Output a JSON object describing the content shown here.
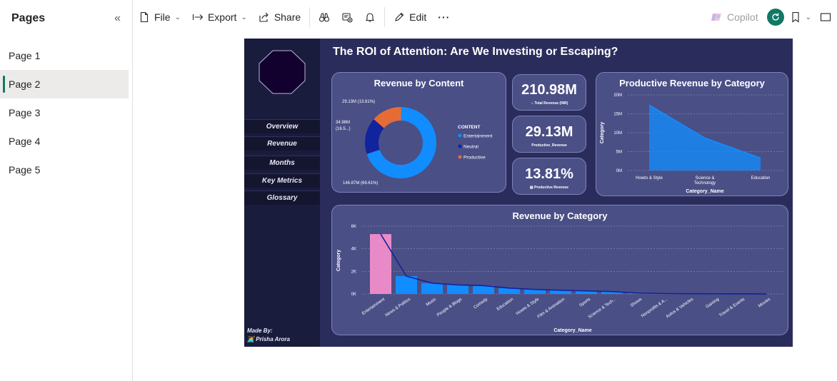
{
  "pages_pane": {
    "title": "Pages",
    "collapse_icon": "double-chevron-left-icon",
    "items": [
      {
        "label": "Page 1"
      },
      {
        "label": "Page 2"
      },
      {
        "label": "Page 3"
      },
      {
        "label": "Page 4"
      },
      {
        "label": "Page 5"
      }
    ],
    "active_index": 1
  },
  "toolbar": {
    "file_label": "File",
    "export_label": "Export",
    "share_label": "Share",
    "edit_label": "Edit",
    "more_label": "···",
    "copilot_label": "Copilot",
    "accent": "#117865"
  },
  "report": {
    "title": "The ROI of Attention: Are We Investing or Escaping?",
    "nav": [
      "Overview",
      "Revenue",
      "Months",
      "Key Metrics",
      "Glossary"
    ],
    "made_by_label": "Made By:",
    "author": "Prisha Arora",
    "kpis": [
      {
        "value": "210.98M",
        "label": "Total Revenue (INR)"
      },
      {
        "value": "29.13M",
        "label": "Productive_Revenue"
      },
      {
        "value": "13.81%",
        "label": "Productive Revenue"
      }
    ]
  },
  "chart_data": [
    {
      "type": "pie",
      "title": "Revenue by Content",
      "legend_title": "CONTENT",
      "legend_position": "right",
      "slices": [
        {
          "name": "Entertainment",
          "value": 146.87,
          "label": "146.87M (69.61%)",
          "color": "#118dff"
        },
        {
          "name": "Neutral",
          "value": 34.98,
          "label": "34.98M (16.5...)",
          "color": "#12239e"
        },
        {
          "name": "Productive",
          "value": 29.13,
          "label": "29.13M (13.81%)",
          "color": "#e66c37"
        }
      ]
    },
    {
      "type": "area",
      "title": "Productive Revenue by Category",
      "xlabel": "Category_Name",
      "ylabel": "Category",
      "categories": [
        "Howto & Style",
        "Science & Technology",
        "Education"
      ],
      "values": [
        17.3,
        8.6,
        3.3
      ],
      "ylim": [
        0,
        20
      ],
      "yticks": [
        "0M",
        "5M",
        "10M",
        "15M",
        "20M"
      ],
      "grid": true,
      "color": "#118dff"
    },
    {
      "type": "bar",
      "title": "Revenue by Category",
      "xlabel": "Category_Name",
      "ylabel": "Category",
      "categories": [
        "Entertainment",
        "News & Politics",
        "Music",
        "People & Blogs",
        "Comedy",
        "Education",
        "Howto & Style",
        "Film & Animation",
        "Sports",
        "Science & Tech...",
        "Shows",
        "Nonprofits & A...",
        "Autos & Vehicles",
        "Gaming",
        "Travel & Events",
        "Movies"
      ],
      "values": [
        5300,
        1580,
        960,
        800,
        740,
        520,
        400,
        330,
        270,
        210,
        80,
        40,
        20,
        15,
        10,
        5
      ],
      "ylim": [
        0,
        6000
      ],
      "yticks": [
        "0K",
        "2K",
        "4K",
        "6K"
      ],
      "grid": true,
      "highlight_color": "#e98ac8",
      "bar_color": "#118dff",
      "line_color": "#12239e"
    }
  ]
}
